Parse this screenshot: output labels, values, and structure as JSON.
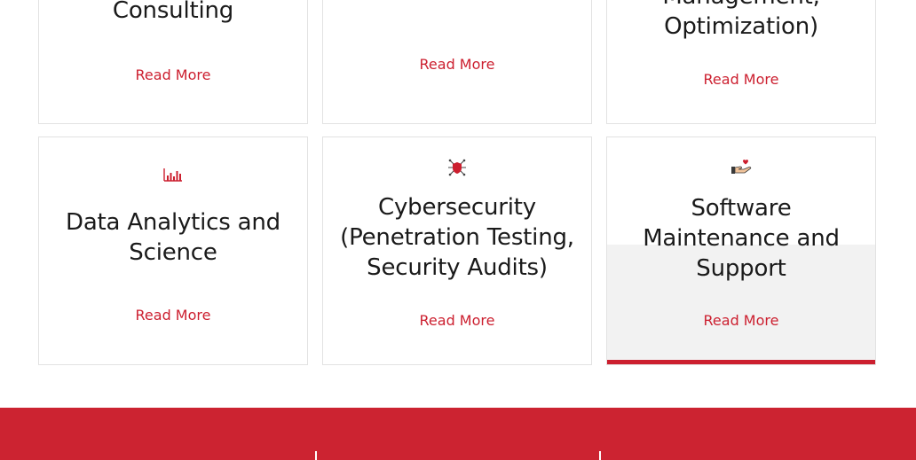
{
  "services": [
    {
      "title_lines": [
        "Consulting"
      ],
      "link": "Read More",
      "icon": null
    },
    {
      "title_lines": [],
      "link": "Read More",
      "icon": null
    },
    {
      "title_lines": [
        "Management,",
        "Optimization)"
      ],
      "link": "Read More",
      "icon": null
    },
    {
      "title_lines": [
        "Data Analytics and",
        "Science"
      ],
      "link": "Read More",
      "icon": "bar-chart-icon"
    },
    {
      "title_lines": [
        "Cybersecurity",
        "(Penetration Testing,",
        "Security Audits)"
      ],
      "link": "Read More",
      "icon": "shield-network-icon"
    },
    {
      "title_lines": [
        "Software",
        "Maintenance and",
        "Support"
      ],
      "link": "Read More",
      "icon": "hand-heart-icon",
      "active": true
    }
  ],
  "colors": {
    "accent": "#cc1f2f",
    "footer": "#cc2331",
    "title": "#1a1a1a",
    "card_border": "#e2e2e2",
    "hover_fill": "#f2f2f2"
  }
}
